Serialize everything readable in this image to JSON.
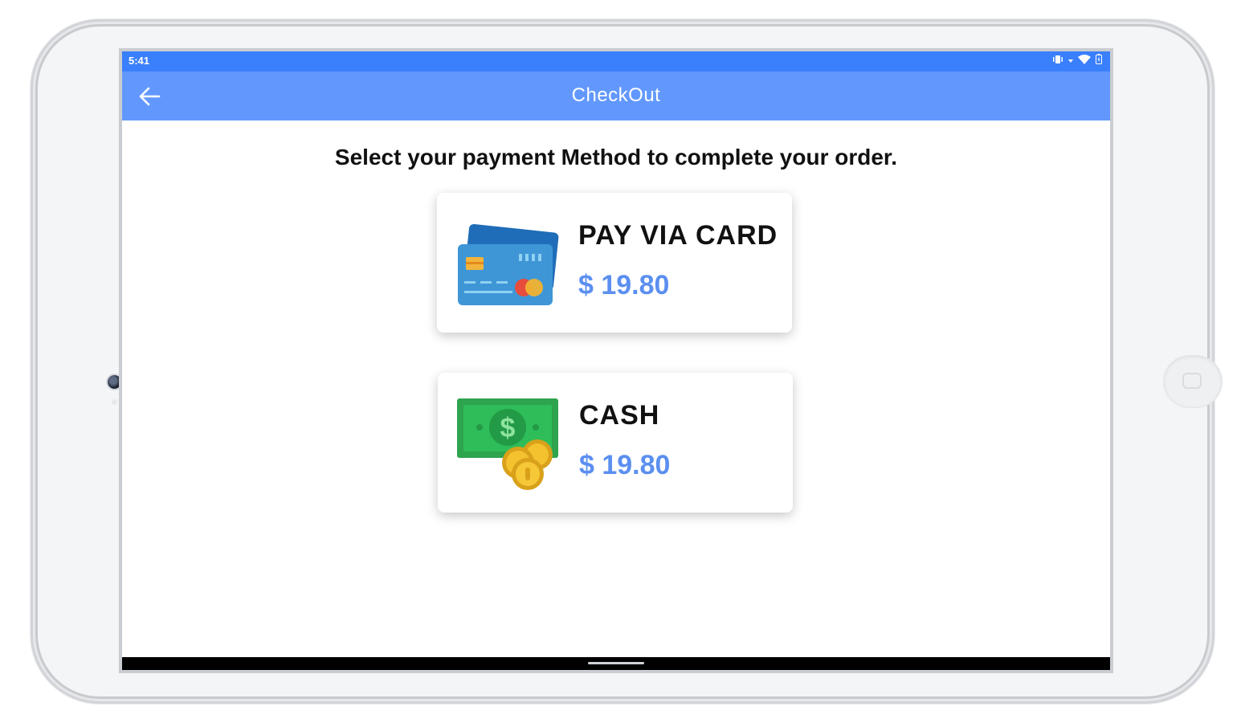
{
  "status_bar": {
    "time": "5:41"
  },
  "app_bar": {
    "title": "CheckOut",
    "back_icon": "arrow-back-icon"
  },
  "main": {
    "headline": "Select your payment Method to complete your order.",
    "options": [
      {
        "title": "PAY VIA CARD",
        "price": "$ 19.80",
        "icon": "credit-card-icon"
      },
      {
        "title": "CASH",
        "price": "$ 19.80",
        "icon": "cash-coins-icon"
      }
    ]
  },
  "colors": {
    "status_bar": "#3a7ffb",
    "app_bar": "#6298fe",
    "price": "#5b8ff0"
  }
}
